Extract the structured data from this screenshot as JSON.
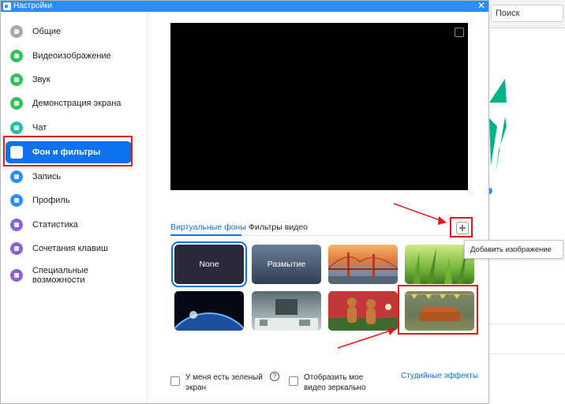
{
  "window": {
    "title": "Настройки",
    "close_glyph": "✕",
    "accent_color": "#2d8cff"
  },
  "sidebar": {
    "items": [
      {
        "label": "Общие",
        "icon": "gear-icon",
        "color": "#a9a9a9",
        "active": false
      },
      {
        "label": "Видеоизображение",
        "icon": "video-icon",
        "color": "#36c25a",
        "active": false
      },
      {
        "label": "Звук",
        "icon": "headphones-icon",
        "color": "#36c25a",
        "active": false
      },
      {
        "label": "Демонстрация экрана",
        "icon": "share-screen-icon",
        "color": "#36c25a",
        "active": false
      },
      {
        "label": "Чат",
        "icon": "chat-icon",
        "color": "#2cbd9f",
        "active": false
      },
      {
        "label": "Фон и фильтры",
        "icon": "background-icon",
        "color": "#ffffff",
        "active": true
      },
      {
        "label": "Запись",
        "icon": "record-icon",
        "color": "#2d8cff",
        "active": false
      },
      {
        "label": "Профиль",
        "icon": "profile-icon",
        "color": "#2d8cff",
        "active": false
      },
      {
        "label": "Статистика",
        "icon": "statistics-icon",
        "color": "#8a63d2",
        "active": false
      },
      {
        "label": "Сочетания клавиш",
        "icon": "keyboard-icon",
        "color": "#8a63d2",
        "active": false
      },
      {
        "label": "Специальные возможности",
        "icon": "accessibility-icon",
        "color": "#8a63d2",
        "active": false
      }
    ]
  },
  "main": {
    "tabs": [
      {
        "label": "Виртуальные фоны",
        "active": true
      },
      {
        "label": "Фильтры видео",
        "active": false
      }
    ],
    "add_tooltip": "Добавить изображение",
    "backgrounds": [
      {
        "label": "None",
        "name": "none",
        "selected": true
      },
      {
        "label": "Размытие",
        "name": "blur",
        "selected": false
      },
      {
        "label": "",
        "name": "golden-gate-bridge",
        "selected": false
      },
      {
        "label": "",
        "name": "green-grass",
        "selected": false
      },
      {
        "label": "",
        "name": "earth-from-space",
        "selected": false
      },
      {
        "label": "",
        "name": "office-room",
        "selected": false
      },
      {
        "label": "",
        "name": "gingerbread-men",
        "selected": false
      },
      {
        "label": "",
        "name": "sofa-room",
        "selected": false
      }
    ],
    "green_screen_label": "У меня есть зеленый экран",
    "mirror_label": "Отобразить мое видео зеркально",
    "studio_effects_label": "Студийные эффекты",
    "link_color": "#0e72ed",
    "highlight_color": "#e0191f"
  },
  "background_app": {
    "search_placeholder": "Поиск"
  }
}
